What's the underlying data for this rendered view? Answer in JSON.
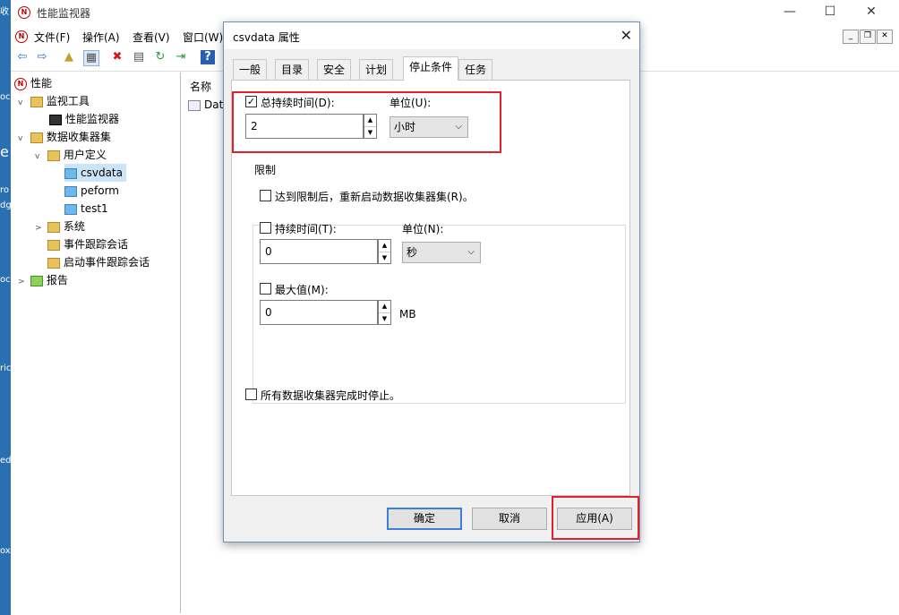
{
  "desktop": {
    "fragments": [
      "收",
      "oc",
      "e",
      "ro",
      "dg",
      "oc",
      "ric",
      "ed",
      "ox"
    ]
  },
  "window": {
    "title": "性能监视器",
    "icon_letter": "N",
    "controls": {
      "minimize": "—",
      "maximize": "☐",
      "close": "✕"
    }
  },
  "menubar": {
    "items": [
      "文件(F)",
      "操作(A)",
      "查看(V)",
      "窗口(W)"
    ],
    "mdi": {
      "minimize": "_",
      "restore": "❐",
      "close": "✕"
    }
  },
  "toolbar": {
    "icons": [
      "back-arrow-icon",
      "forward-arrow-icon",
      "up-folder-icon",
      "show-hide-tree-icon",
      "delete-icon",
      "properties-icon",
      "refresh-icon",
      "export-icon",
      "help-icon"
    ],
    "glyphs": [
      "⇦",
      "⇨",
      "▲",
      "▦",
      "✖",
      "▤",
      "↻",
      "⇥",
      "?"
    ]
  },
  "tree": {
    "nodes": [
      {
        "label": "性能",
        "expander": "",
        "icon": "performance-icon"
      },
      {
        "label": "监视工具",
        "expander": "v",
        "icon": "folder-icon"
      },
      {
        "label": "性能监视器",
        "expander": "",
        "icon": "monitor-icon"
      },
      {
        "label": "数据收集器集",
        "expander": "v",
        "icon": "folder-icon"
      },
      {
        "label": "用户定义",
        "expander": "v",
        "icon": "folder-icon"
      },
      {
        "label": "csvdata",
        "expander": "",
        "icon": "collector-icon"
      },
      {
        "label": "peform",
        "expander": "",
        "icon": "collector-icon"
      },
      {
        "label": "test1",
        "expander": "",
        "icon": "collector-icon"
      },
      {
        "label": "系统",
        "expander": ">",
        "icon": "folder-icon"
      },
      {
        "label": "事件跟踪会话",
        "expander": "",
        "icon": "folder-icon"
      },
      {
        "label": "启动事件跟踪会话",
        "expander": "",
        "icon": "folder-icon"
      },
      {
        "label": "报告",
        "expander": ">",
        "icon": "report-folder-icon"
      }
    ]
  },
  "list": {
    "header": "名称",
    "row": "Data"
  },
  "dialog": {
    "title": "csvdata 属性",
    "close": "✕",
    "tabs": [
      "一般",
      "目录",
      "安全",
      "计划",
      "停止条件",
      "任务"
    ],
    "active_tab": "停止条件",
    "overall_duration": {
      "label": "总持续时间(D):",
      "checked": true,
      "value": "2",
      "unit_label": "单位(U):",
      "unit_value": "小时"
    },
    "limits": {
      "group_label": "限制",
      "restart_label": "达到限制后，重新启动数据收集器集(R)。",
      "duration_label": "持续时间(T):",
      "duration_value": "0",
      "unit_label": "单位(N):",
      "unit_value": "秒",
      "max_label": "最大值(M):",
      "max_value": "0",
      "max_unit": "MB"
    },
    "stop_all_label": "所有数据收集器完成时停止。",
    "buttons": {
      "ok": "确定",
      "cancel": "取消",
      "apply": "应用(A)"
    },
    "check_mark": "✓",
    "spin": {
      "up": "▲",
      "down": "▼"
    },
    "combo_arrow": "⌵"
  }
}
